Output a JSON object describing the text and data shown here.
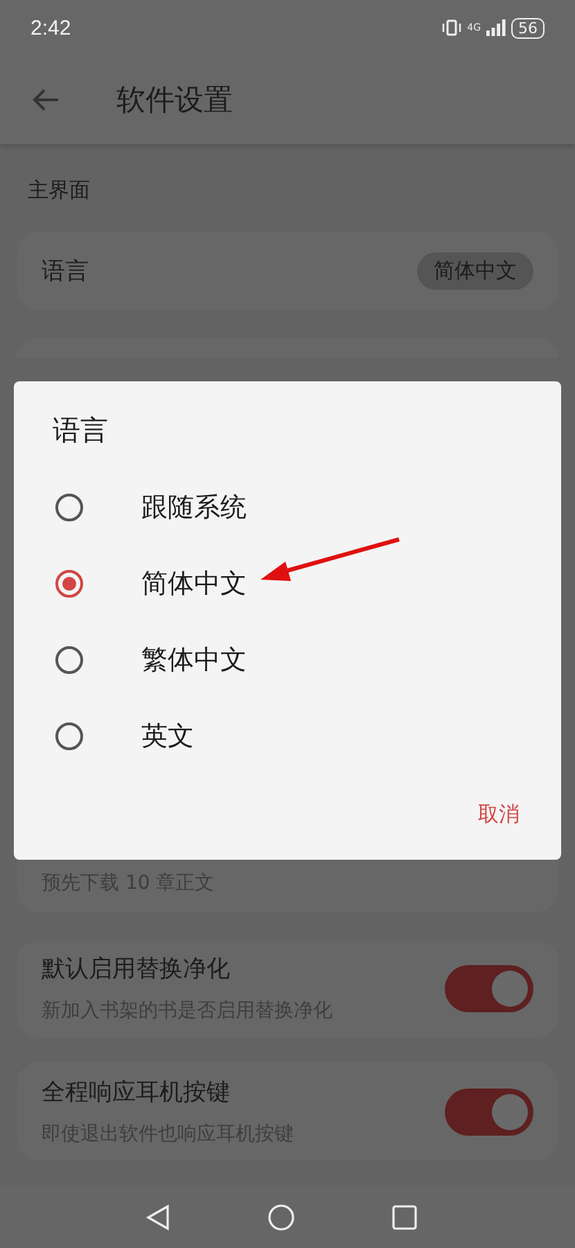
{
  "status_bar": {
    "time": "2:42",
    "network": "4G",
    "battery": "56"
  },
  "app_bar": {
    "title": "软件设置"
  },
  "section_header": "主界面",
  "settings": [
    {
      "kind": "value",
      "title": "语言",
      "value": "简体中文"
    },
    {
      "kind": "text",
      "summary": "预先下载 10 章正文"
    },
    {
      "kind": "switch",
      "title": "默认启用替换净化",
      "summary": "新加入书架的书是否启用替换净化",
      "on": true
    },
    {
      "kind": "switch",
      "title": "全程响应耳机按键",
      "summary": "即使退出软件也响应耳机按键",
      "on": true
    }
  ],
  "dialog": {
    "title": "语言",
    "options": [
      {
        "label": "跟随系统",
        "selected": false
      },
      {
        "label": "简体中文",
        "selected": true
      },
      {
        "label": "繁体中文",
        "selected": false
      },
      {
        "label": "英文",
        "selected": false
      }
    ],
    "cancel": "取消"
  }
}
